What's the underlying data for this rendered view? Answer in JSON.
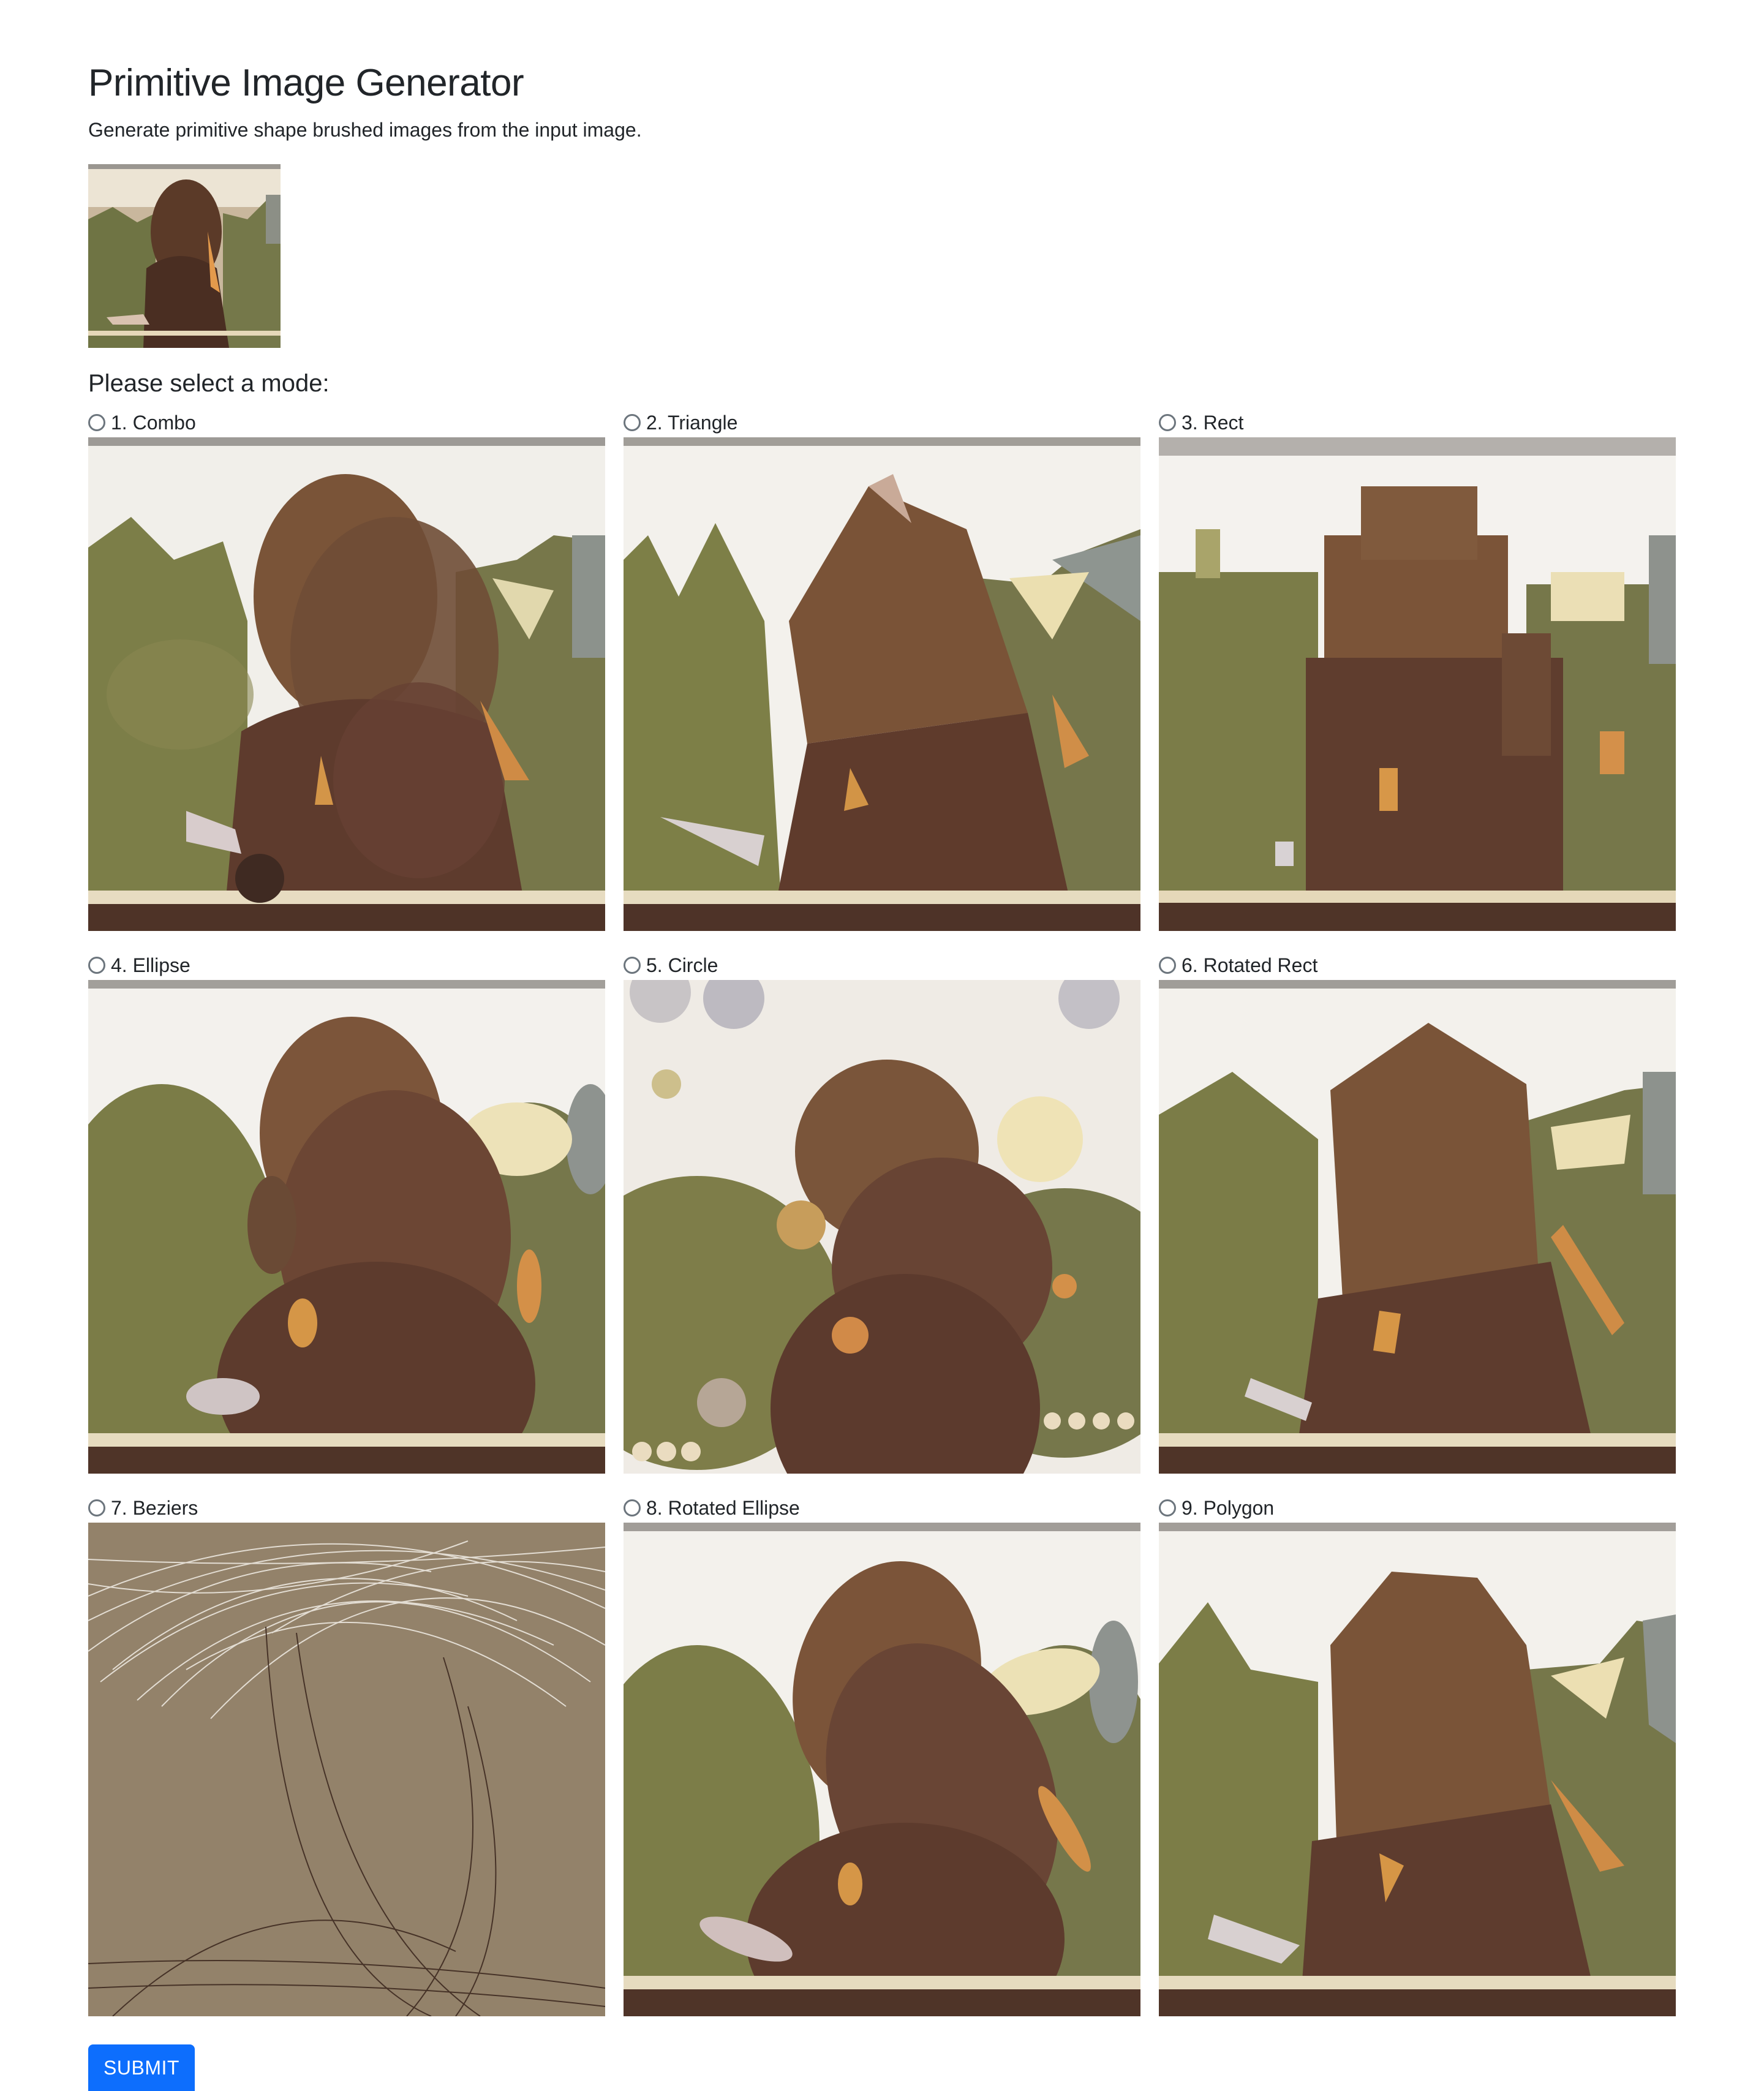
{
  "header": {
    "title": "Primitive Image Generator",
    "subtitle": "Generate primitive shape brushed images from the input image."
  },
  "form": {
    "prompt": "Please select a mode:",
    "submit_label": "SUBMIT"
  },
  "modes": [
    {
      "label": "1. Combo",
      "checked": false
    },
    {
      "label": "2. Triangle",
      "checked": false
    },
    {
      "label": "3. Rect",
      "checked": false
    },
    {
      "label": "4. Ellipse",
      "checked": false
    },
    {
      "label": "5. Circle",
      "checked": false
    },
    {
      "label": "6. Rotated Rect",
      "checked": false
    },
    {
      "label": "7. Beziers",
      "checked": false
    },
    {
      "label": "8. Rotated Ellipse",
      "checked": false
    },
    {
      "label": "9. Polygon",
      "checked": false
    }
  ],
  "colors": {
    "primary": "#0d6efd",
    "sky": "#f4f2ee",
    "hair": "#7a5339",
    "body": "#5e3c2d",
    "foliage": "#7d7c47",
    "rail": "#e9dcbf",
    "bezier_bg": "#93826a"
  }
}
